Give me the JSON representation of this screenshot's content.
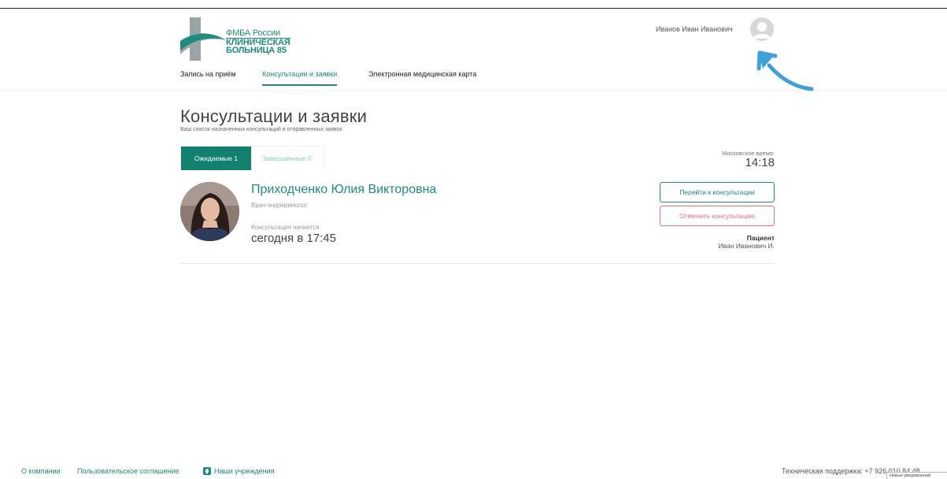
{
  "header": {
    "logo": {
      "line1": "ФМБА России",
      "line2": "КЛИНИЧЕСКАЯ",
      "line3": "БОЛЬНИЦА 85"
    },
    "nav": [
      {
        "label": "Запись на приём",
        "active": false
      },
      {
        "label": "Консультации и заявки",
        "active": true
      },
      {
        "label": "Электронная медицинская карта",
        "active": false
      }
    ],
    "user_name": "Иванов Иван Иванович"
  },
  "main": {
    "title": "Консультации и заявки",
    "subtitle": "Ваш список назначенных консультаций и отправленных заявок",
    "tabs": [
      {
        "label": "Ожидаемые 1",
        "active": true
      },
      {
        "label": "Завершённые 0",
        "active": false
      }
    ],
    "moscow_time_label": "Московское время:",
    "moscow_time": "14:18",
    "consultation": {
      "doctor_name": "Приходченко Юлия Викторовна",
      "doctor_specialty": "Врач-эндокринолог",
      "starts_label": "Консультация начнется",
      "starts_value": "сегодня в 17:45",
      "go_button": "Перейти к консультации",
      "cancel_button": "Отменить консультацию",
      "patient_label": "Пациент",
      "patient_name": "Иван Иванович И."
    }
  },
  "footer": {
    "about": "О компании",
    "terms": "Пользовательское соглашение",
    "institutions": "Наши учреждения",
    "support_label": "Техническая поддержка:",
    "support_phone": "+7 926 010 84 48",
    "notifications_badge": "Новых уведомлений"
  },
  "colors": {
    "accent": "#1f8a7e",
    "accent_dark": "#12806f",
    "danger": "#e6707d",
    "annotation_arrow": "#3fa0d8"
  }
}
